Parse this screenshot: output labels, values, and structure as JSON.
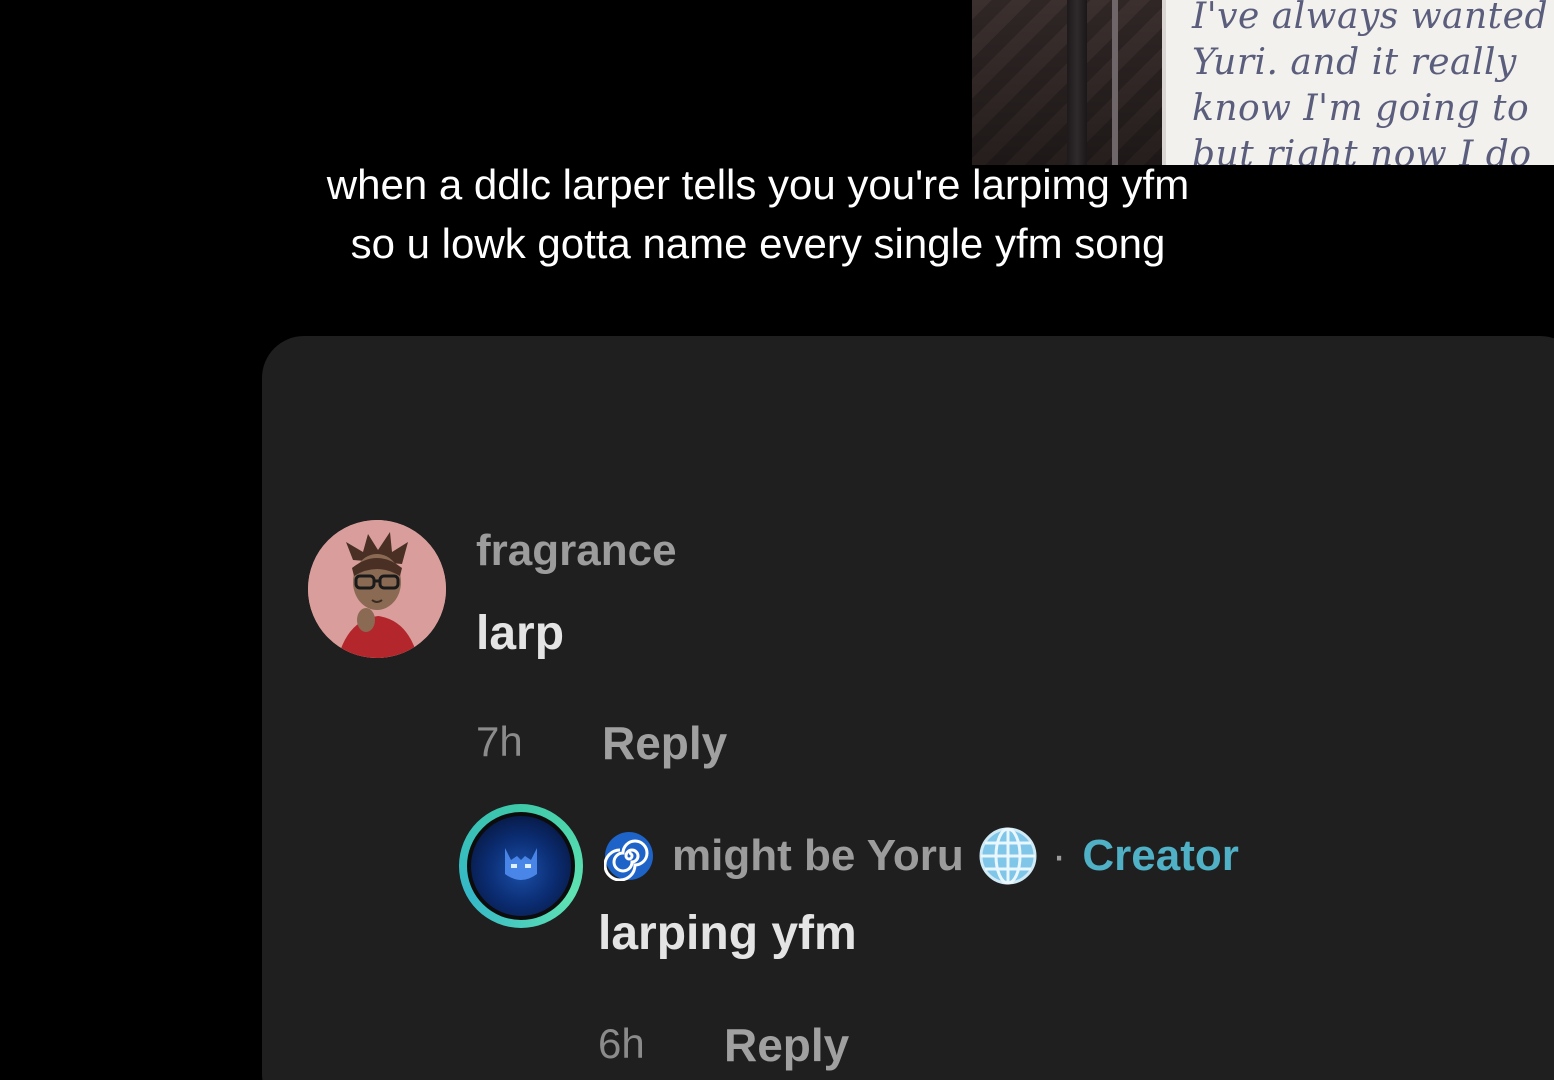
{
  "inset_note": {
    "lines": [
      "I've always wanted",
      "Yuri. and it really",
      "know I'm going to",
      "but right now I do"
    ]
  },
  "caption": {
    "line1": "when a ddlc larper tells you you're larpimg yfm",
    "line2": "so u lowk gotta name every single yfm song"
  },
  "comments": [
    {
      "username": "fragrance",
      "text": "larp",
      "time": "7h",
      "reply_label": "Reply"
    },
    {
      "username": "might be Yoru",
      "separator": "·",
      "badge": "Creator",
      "text": "larping yfm",
      "time": "6h",
      "reply_label": "Reply",
      "prefix_icon": "spiral-icon",
      "suffix_icon": "globe-icon"
    }
  ],
  "colors": {
    "background": "#000000",
    "panel": "#1f1f1f",
    "creator_accent": "#4fb0c6",
    "avatar_ring": "#3ec9a8"
  }
}
